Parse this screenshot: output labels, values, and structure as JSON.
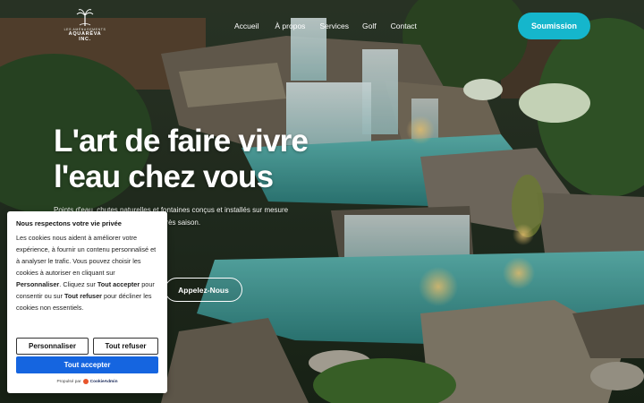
{
  "header": {
    "logo_small": "LES AMÉNAGEMENTS",
    "logo_name": "AQUARÊVA INC.",
    "nav": [
      "Accueil",
      "À propos",
      "Services",
      "Golf",
      "Contact"
    ],
    "cta_label": "Soumission",
    "cta_color": "#15b6cc"
  },
  "hero": {
    "title_line1": "L'art de faire vivre",
    "title_line2": "l'eau chez vous",
    "subtitle_line1": "Points d'eau, chutes naturelles et fontaines conçus et installés sur mesure",
    "subtitle_line2": "pour durer et émerveiller, saison après saison.",
    "button_label": "Appelez-Nous"
  },
  "cookie": {
    "title": "Nous respectons votre vie privée",
    "text_part1": "Les cookies nous aident à améliorer votre expérience, à fournir un contenu personnalisé et à analyser le trafic. Vous pouvez choisir les cookies à autoriser en cliquant sur ",
    "text_bold1": "Personnaliser",
    "text_part2": ". Cliquez sur ",
    "text_bold2": "Tout accepter",
    "text_part3": " pour consentir ou sur ",
    "text_bold3": "Tout refuser",
    "text_part4": " pour décliner les cookies non essentiels.",
    "customize_label": "Personnaliser",
    "reject_label": "Tout refuser",
    "accept_label": "Tout accepter",
    "accept_color": "#1565e0",
    "powered_prefix": "Propulsé par",
    "powered_brand": "CookieAdmin"
  }
}
